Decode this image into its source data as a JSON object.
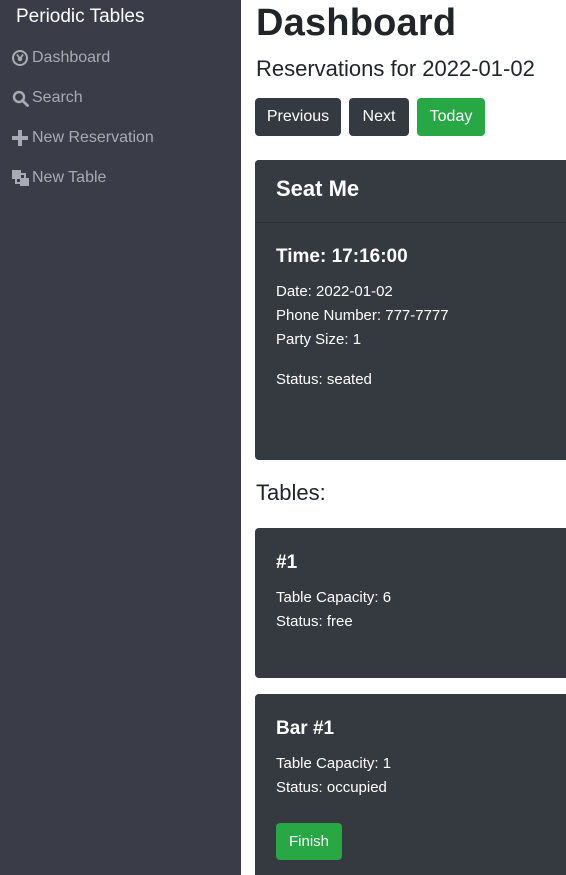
{
  "sidebar": {
    "brand": "Periodic Tables",
    "items": [
      {
        "label": "Dashboard",
        "icon": "dashboard-icon"
      },
      {
        "label": "Search",
        "icon": "search-icon"
      },
      {
        "label": "New Reservation",
        "icon": "plus-icon"
      },
      {
        "label": "New Table",
        "icon": "layers-icon"
      }
    ]
  },
  "header": {
    "title": "Dashboard",
    "subtitle": "Reservations for 2022-01-02"
  },
  "controls": {
    "previous": "Previous",
    "next": "Next",
    "today": "Today"
  },
  "reservation": {
    "header": "Seat Me",
    "time": "Time: 17:16:00",
    "date": "Date: 2022-01-02",
    "phone": "Phone Number: 777-7777",
    "party_size": "Party Size: 1",
    "status": "Status: seated"
  },
  "tables_heading": "Tables:",
  "tables": [
    {
      "name": "#1",
      "capacity": "Table Capacity: 6",
      "status": "Status: free"
    },
    {
      "name": "Bar #1",
      "capacity": "Table Capacity: 1",
      "status": "Status: occupied",
      "action": "Finish"
    }
  ],
  "colors": {
    "sidebar_bg": "#3a3d48",
    "card_bg": "#343a40",
    "accent_green": "#28a745",
    "nav_text": "#a8abb2"
  }
}
